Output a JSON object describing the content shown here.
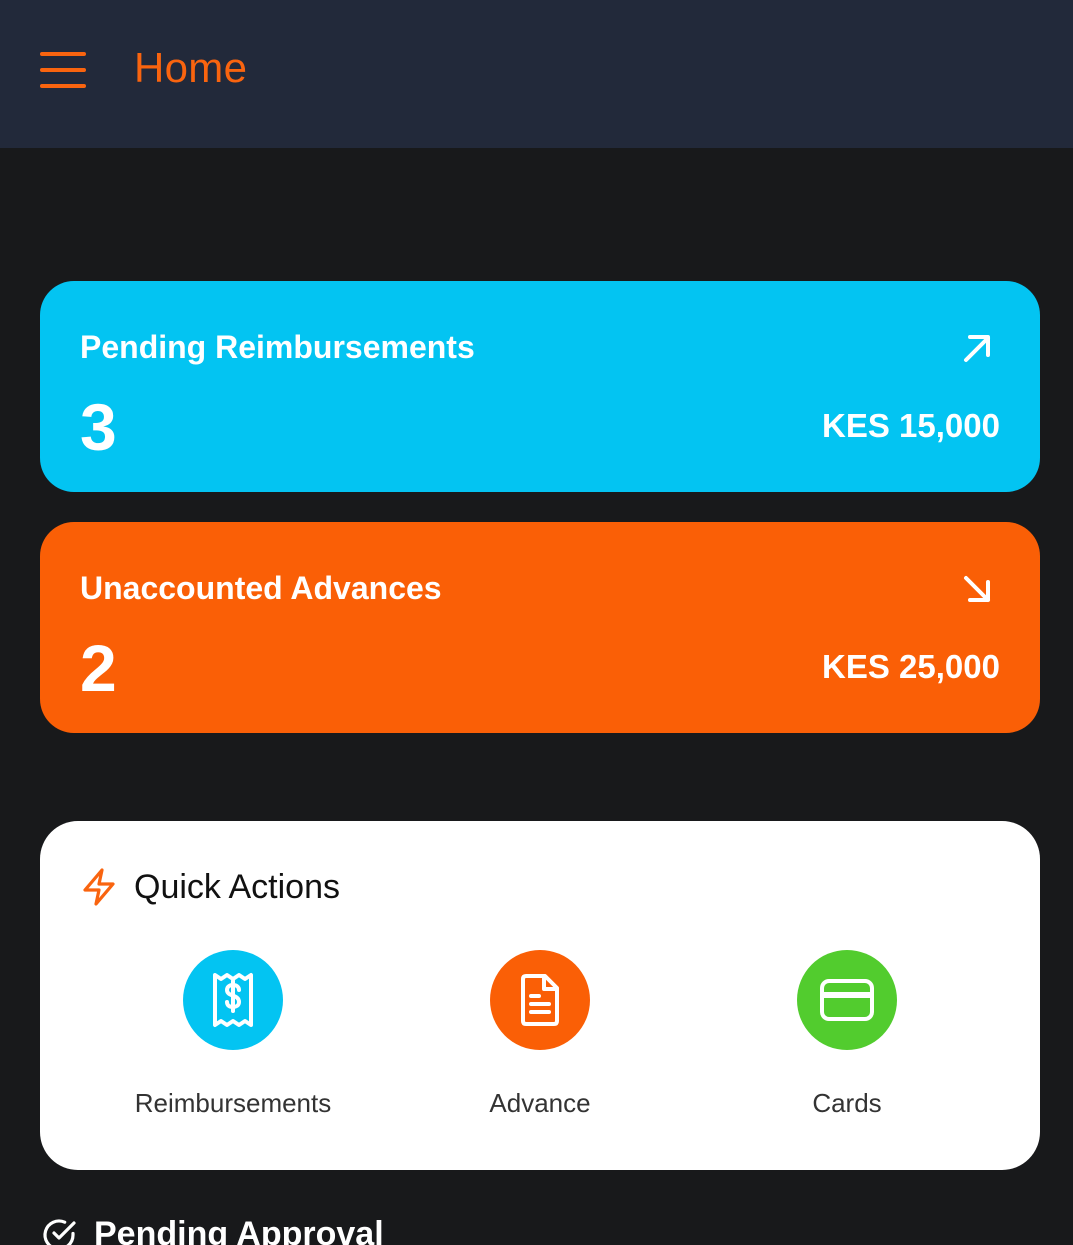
{
  "app_bar": {
    "title": "Home",
    "menu_icon": "hamburger-menu-icon",
    "background": "#22293a",
    "accent": "#f9640f"
  },
  "stats": [
    {
      "label": "Pending Reimbursements",
      "count": "3",
      "amount": "KES 15,000",
      "icon": "arrow-up-right-icon",
      "color": "#03c4f2"
    },
    {
      "label": "Unaccounted Advances",
      "count": "2",
      "amount": "KES 25,000",
      "icon": "arrow-down-right-icon",
      "color": "#fa5f06"
    }
  ],
  "quick_actions": {
    "title": "Quick Actions",
    "icon": "lightning-icon",
    "items": [
      {
        "label": "Reimbursements",
        "icon": "receipt-dollar-icon",
        "color": "#03c4f2"
      },
      {
        "label": "Advance",
        "icon": "document-icon",
        "color": "#fa5f06"
      },
      {
        "label": "Cards",
        "icon": "credit-card-icon",
        "color": "#52cc2e"
      }
    ]
  },
  "pending_approval": {
    "title": "Pending Approval",
    "icon": "check-circle-icon"
  }
}
